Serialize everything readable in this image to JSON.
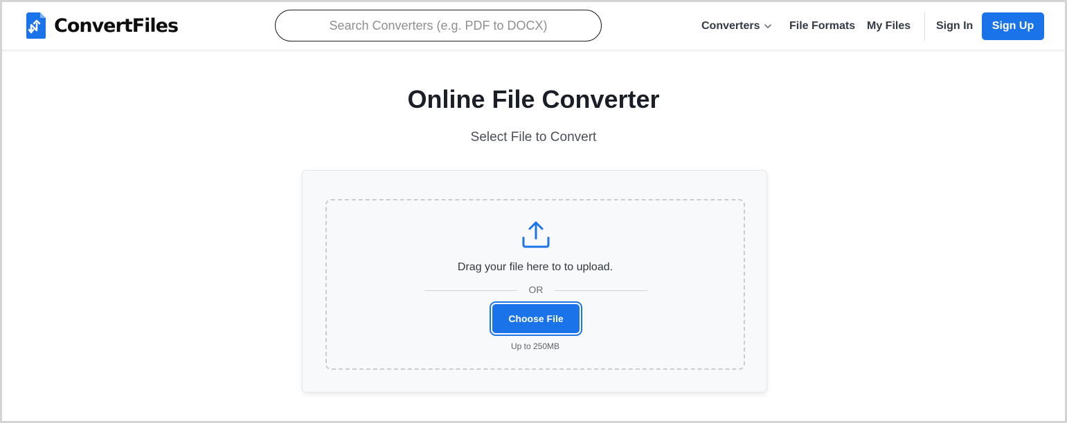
{
  "brand": {
    "name": "ConvertFiles",
    "color": "#1a73e8"
  },
  "header": {
    "search_placeholder": "Search Converters (e.g. PDF to DOCX)",
    "nav": {
      "converters": "Converters",
      "file_formats": "File Formats",
      "my_files": "My Files",
      "sign_in": "Sign In",
      "sign_up": "Sign Up"
    }
  },
  "main": {
    "title": "Online File Converter",
    "subtitle": "Select File to Convert",
    "dropzone": {
      "drag_text": "Drag your file here to to upload.",
      "or_text": "OR",
      "choose_button": "Choose File",
      "limit_text": "Up to 250MB"
    }
  },
  "icons": {
    "logo": "file-convert-icon",
    "dropdown": "chevron-down-icon",
    "upload": "upload-icon"
  }
}
